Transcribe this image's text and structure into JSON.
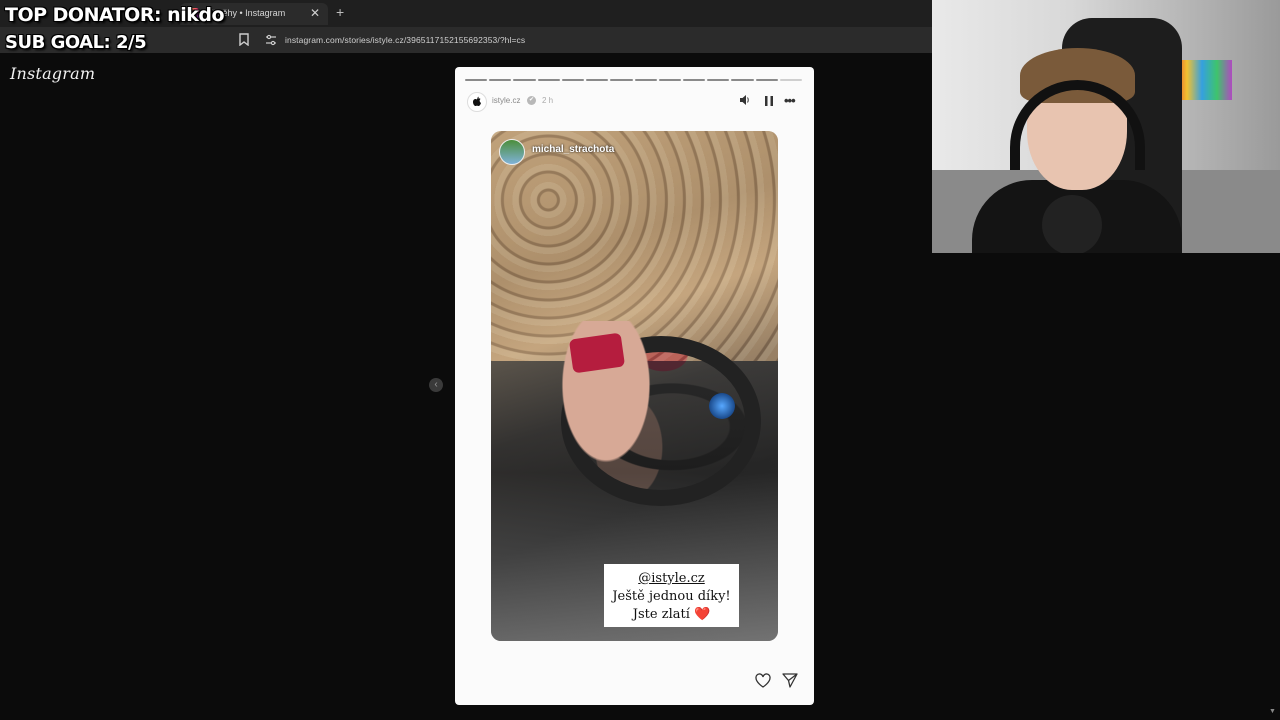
{
  "browser": {
    "tab_title": "Příběhy • Instagram",
    "tab_close": "✕",
    "new_tab": "+",
    "url": "instagram.com/stories/istyle.cz/3965117152155692353/?hl=cs"
  },
  "overlay": {
    "top_donator": "TOP DONATOR: nikdo",
    "sub_goal": "SUB GOAL: 2/5"
  },
  "instagram": {
    "logo": "Instagram",
    "prev_arrow": "‹",
    "story": {
      "progress_total": 14,
      "progress_seen": 13,
      "username": "istyle.cz",
      "verified": "✔",
      "time": "2 h",
      "more": "•••",
      "avatar_glyph": "",
      "shared_post": {
        "username": "michal_strachota",
        "sticker_mention": "@istyle.cz",
        "sticker_line1": "Ještě jednou díky!",
        "sticker_line2": "Jste zlatí ❤️"
      }
    }
  },
  "icons": {
    "bookmark": "bookmark-icon",
    "site_info": "site-info-icon",
    "sound": "sound-icon",
    "pause": "pause-icon",
    "more": "more-icon",
    "like": "heart-icon",
    "share": "send-icon"
  },
  "colors": {
    "page_bg": "#0b0b0b",
    "story_bg": "#fbfbfb",
    "accent_red": "#b51d3e"
  }
}
